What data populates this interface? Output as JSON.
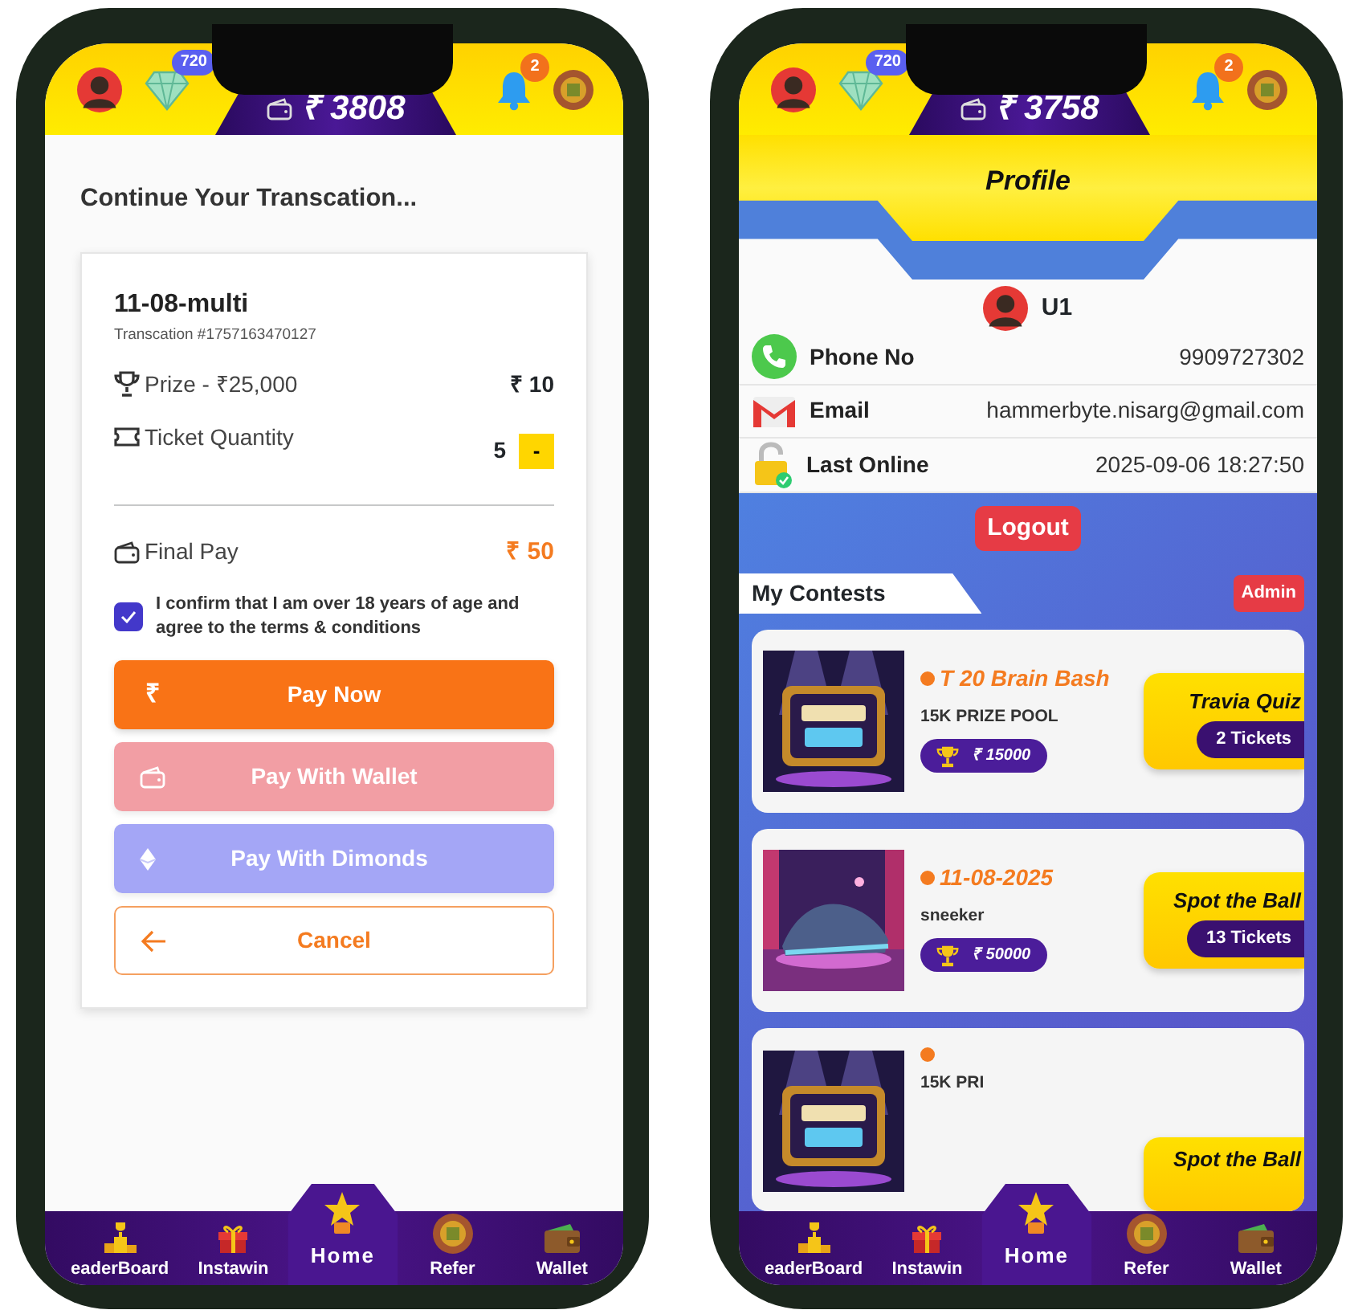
{
  "phones": [
    {
      "header": {
        "diamonds": "720",
        "balance": "₹ 3808",
        "notifications": "2"
      },
      "screen": {
        "kind": "transaction",
        "title": "Continue Your Transcation...",
        "card": {
          "name": "11-08-multi",
          "transaction": "Transcation #1757163470127",
          "prize_label": "Prize - ₹25,000",
          "price": "₹ 10",
          "quantity_label": "Ticket Quantity",
          "quantity": "5",
          "decrease": "-",
          "final_label": "Final Pay",
          "final_amount": "₹ 50",
          "consent": {
            "text": "I confirm that I am over 18 years of age and agree to the terms & conditions",
            "checked": true
          },
          "buttons": [
            {
              "kind": "rupee",
              "icon": "₹",
              "label": "Pay Now",
              "disabled": false
            },
            {
              "kind": "wallet",
              "label": "Pay With Wallet",
              "disabled": true
            },
            {
              "kind": "diamond",
              "label": "Pay With Dimonds",
              "disabled": true
            },
            {
              "kind": "back",
              "label": "Cancel",
              "disabled": false
            }
          ]
        }
      },
      "bottom_nav": [
        {
          "kind": "podium",
          "label": "eaderBoard",
          "selected": false
        },
        {
          "kind": "gift",
          "label": "Instawin",
          "selected": false
        },
        {
          "kind": "star",
          "label": "Home",
          "selected": true
        },
        {
          "kind": "coin",
          "label": "Refer",
          "selected": false
        },
        {
          "kind": "wallet",
          "label": "Wallet",
          "selected": false
        }
      ]
    },
    {
      "header": {
        "diamonds": "720",
        "balance": "₹ 3758",
        "notifications": "2"
      },
      "screen": {
        "kind": "profile",
        "title": "Profile",
        "user": "U1",
        "details": [
          {
            "kind": "phone",
            "label": "Phone No",
            "value": "9909727302"
          },
          {
            "kind": "email",
            "label": "Email",
            "value": "hammerbyte.nisarg@gmail.com"
          },
          {
            "kind": "online",
            "label": "Last Online",
            "value": "2025-09-06 18:27:50"
          }
        ],
        "logout": "Logout",
        "section": "My Contests",
        "badge": "Admin",
        "contests": [
          {
            "title": "T 20 Brain Bash",
            "subtitle": "15K PRIZE POOL",
            "prize": "₹ 15000",
            "game": "Travia Quiz",
            "tickets": "2 Tickets"
          },
          {
            "title": "11-08-2025",
            "subtitle": "sneeker",
            "prize": "₹ 50000",
            "game": "Spot the Ball",
            "tickets": "13 Tickets"
          },
          {
            "subtitle": "15K PRI",
            "game": "Spot the Ball"
          }
        ]
      },
      "bottom_nav": [
        {
          "kind": "podium",
          "label": "eaderBoard",
          "selected": false
        },
        {
          "kind": "gift",
          "label": "Instawin",
          "selected": false
        },
        {
          "kind": "star",
          "label": "Home",
          "selected": true
        },
        {
          "kind": "coin",
          "label": "Refer",
          "selected": false
        },
        {
          "kind": "wallet",
          "label": "Wallet",
          "selected": false
        }
      ]
    }
  ]
}
